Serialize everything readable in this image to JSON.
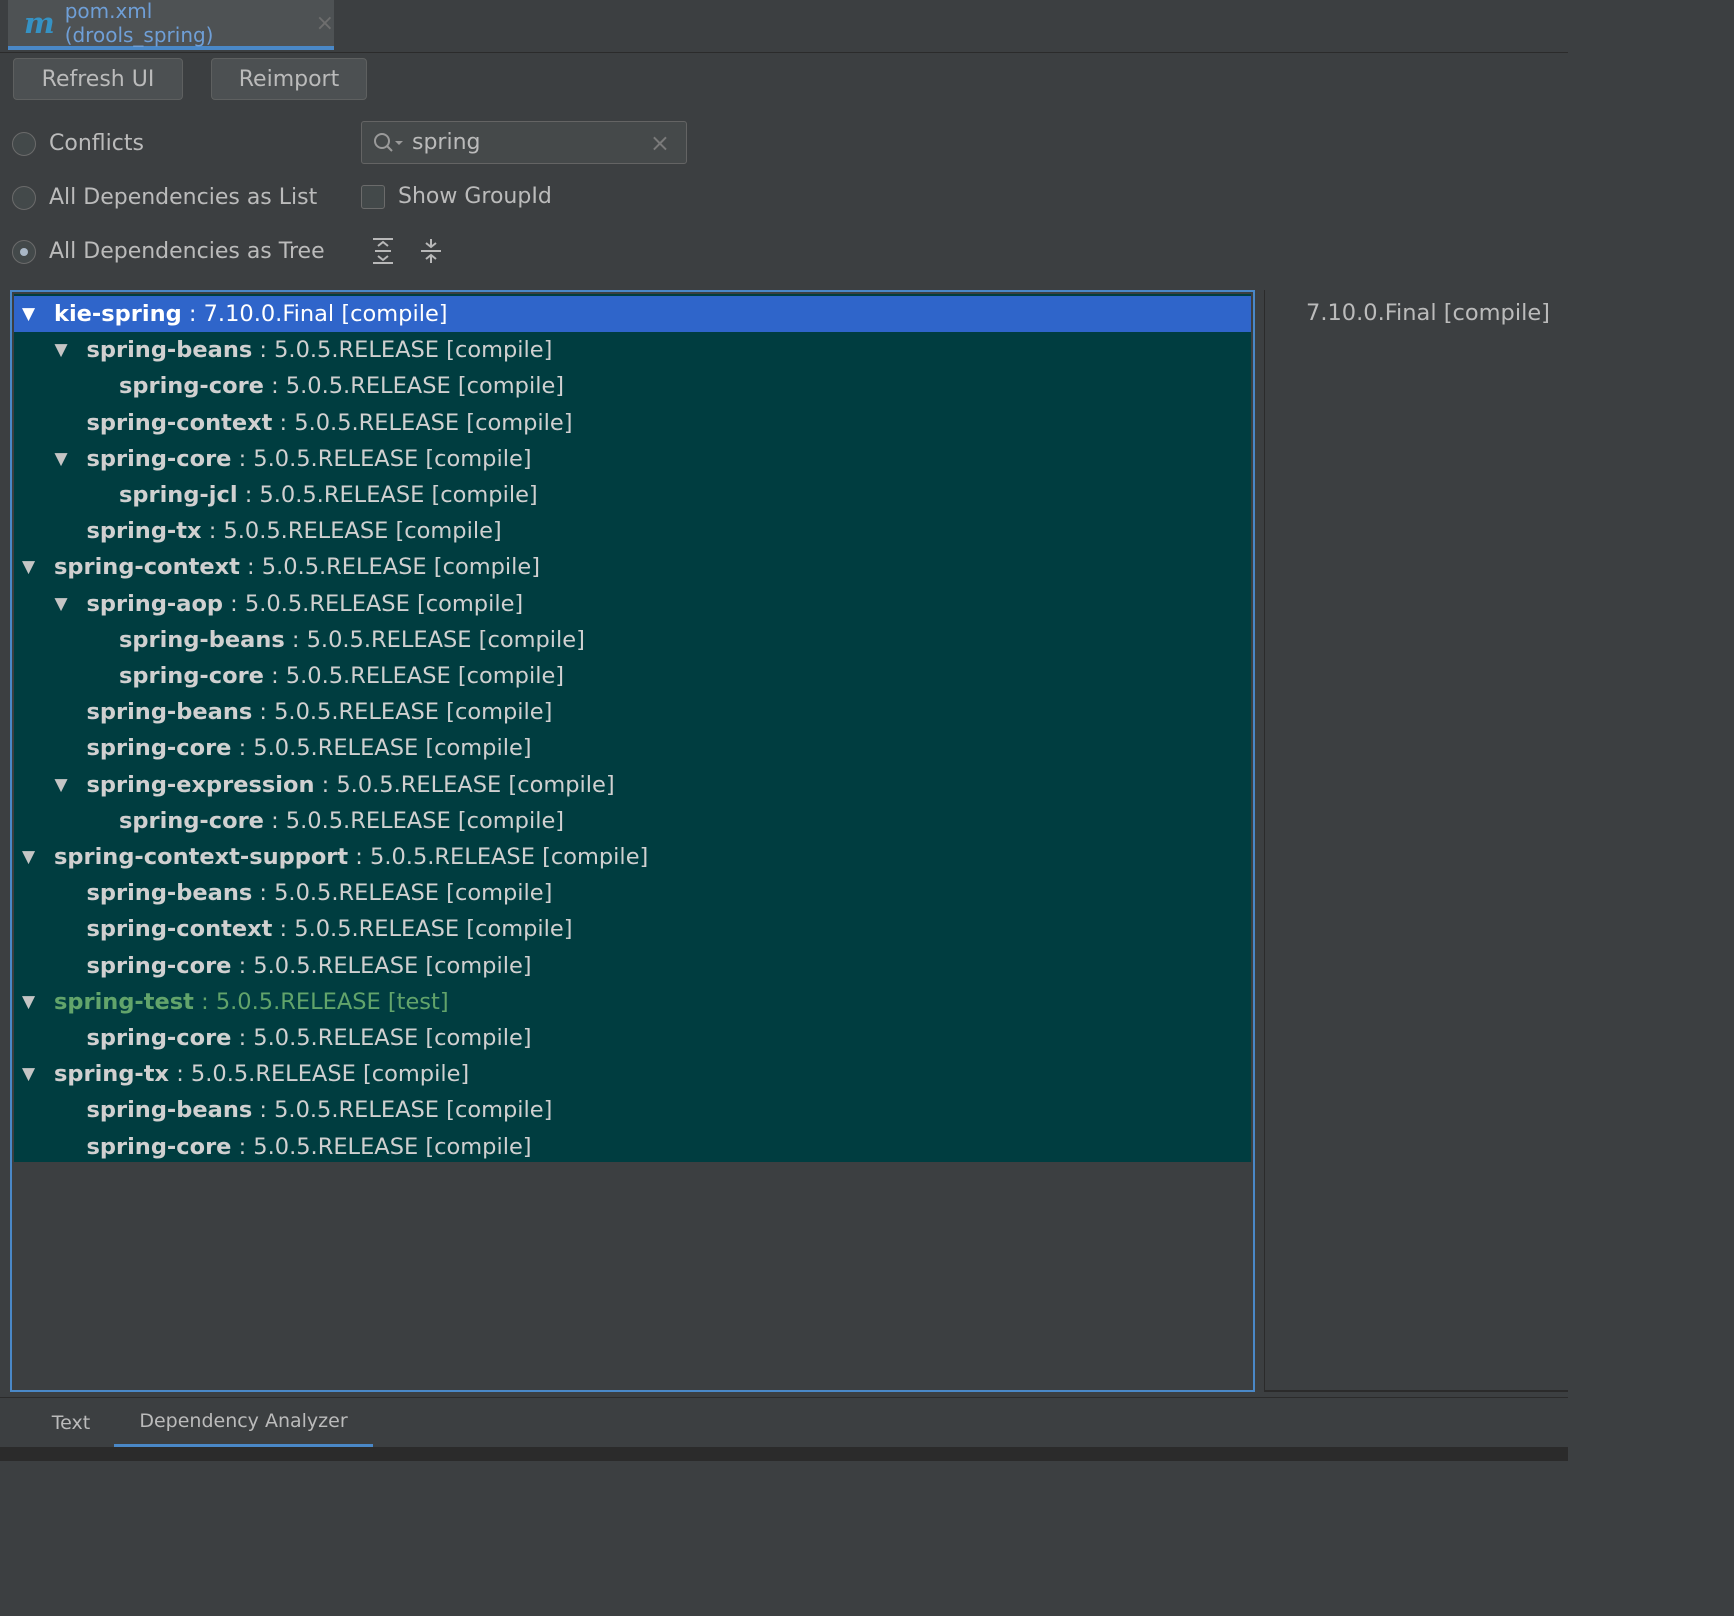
{
  "editor_tab": {
    "icon": "maven-m-icon",
    "icon_glyph": "m",
    "title": "pom.xml (drools_spring)",
    "close_glyph": "×"
  },
  "toolbar": {
    "refresh_label": "Refresh UI",
    "reimport_label": "Reimport"
  },
  "modes": {
    "conflicts_label": "Conflicts",
    "list_label": "All Dependencies as List",
    "tree_label": "All Dependencies as Tree",
    "selected": "tree"
  },
  "search": {
    "value": "spring",
    "clear_glyph": "×"
  },
  "show_group_id": {
    "label": "Show GroupId",
    "checked": false
  },
  "tree": {
    "rows": [
      {
        "name": "kie-spring",
        "ver": " : 7.10.0.Final [compile]",
        "level": 0,
        "expanded": true,
        "selected": true
      },
      {
        "name": "spring-beans",
        "ver": " : 5.0.5.RELEASE [compile]",
        "level": 1,
        "expanded": true
      },
      {
        "name": "spring-core",
        "ver": " : 5.0.5.RELEASE [compile]",
        "level": 2
      },
      {
        "name": "spring-context",
        "ver": " : 5.0.5.RELEASE [compile]",
        "level": 1
      },
      {
        "name": "spring-core",
        "ver": " : 5.0.5.RELEASE [compile]",
        "level": 1,
        "expanded": true
      },
      {
        "name": "spring-jcl",
        "ver": " : 5.0.5.RELEASE [compile]",
        "level": 2
      },
      {
        "name": "spring-tx",
        "ver": " : 5.0.5.RELEASE [compile]",
        "level": 1
      },
      {
        "name": "spring-context",
        "ver": " : 5.0.5.RELEASE [compile]",
        "level": 0,
        "expanded": true
      },
      {
        "name": "spring-aop",
        "ver": " : 5.0.5.RELEASE [compile]",
        "level": 1,
        "expanded": true
      },
      {
        "name": "spring-beans",
        "ver": " : 5.0.5.RELEASE [compile]",
        "level": 2
      },
      {
        "name": "spring-core",
        "ver": " : 5.0.5.RELEASE [compile]",
        "level": 2
      },
      {
        "name": "spring-beans",
        "ver": " : 5.0.5.RELEASE [compile]",
        "level": 1
      },
      {
        "name": "spring-core",
        "ver": " : 5.0.5.RELEASE [compile]",
        "level": 1
      },
      {
        "name": "spring-expression",
        "ver": " : 5.0.5.RELEASE [compile]",
        "level": 1,
        "expanded": true
      },
      {
        "name": "spring-core",
        "ver": " : 5.0.5.RELEASE [compile]",
        "level": 2
      },
      {
        "name": "spring-context-support",
        "ver": " : 5.0.5.RELEASE [compile]",
        "level": 0,
        "expanded": true
      },
      {
        "name": "spring-beans",
        "ver": " : 5.0.5.RELEASE [compile]",
        "level": 1
      },
      {
        "name": "spring-context",
        "ver": " : 5.0.5.RELEASE [compile]",
        "level": 1
      },
      {
        "name": "spring-core",
        "ver": " : 5.0.5.RELEASE [compile]",
        "level": 1
      },
      {
        "name": "spring-test",
        "ver": " : 5.0.5.RELEASE [test]",
        "level": 0,
        "expanded": true,
        "test": true
      },
      {
        "name": "spring-core",
        "ver": " : 5.0.5.RELEASE [compile]",
        "level": 1
      },
      {
        "name": "spring-tx",
        "ver": " : 5.0.5.RELEASE [compile]",
        "level": 0,
        "expanded": true
      },
      {
        "name": "spring-beans",
        "ver": " : 5.0.5.RELEASE [compile]",
        "level": 1
      },
      {
        "name": "spring-core",
        "ver": " : 5.0.5.RELEASE [compile]",
        "level": 1
      }
    ]
  },
  "detail": {
    "text": "7.10.0.Final [compile]"
  },
  "bottom_tabs": {
    "text_label": "Text",
    "analyzer_label": "Dependency Analyzer",
    "active": "analyzer"
  },
  "colors": {
    "selection": "#2f65ca",
    "tree_bg": "#003d40",
    "test_scope": "#62a46b",
    "accent": "#4a88c7"
  }
}
